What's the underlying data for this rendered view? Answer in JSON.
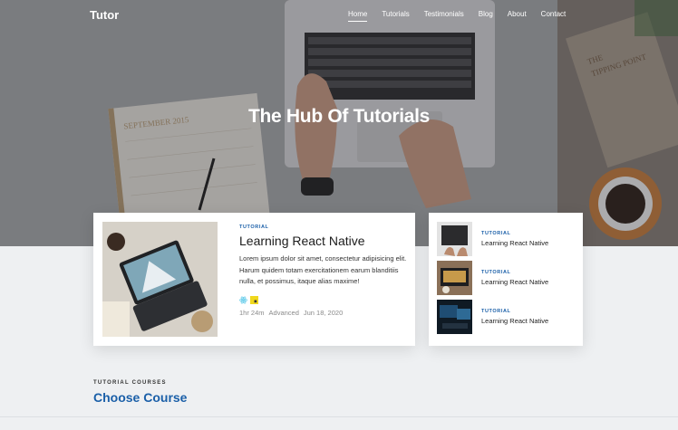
{
  "brand": "Tutor",
  "nav": {
    "items": [
      "Home",
      "Tutorials",
      "Testimonials",
      "Blog",
      "About",
      "Contact"
    ],
    "active": "Home"
  },
  "hero": {
    "title_pre": "The ",
    "title_bold1": "Hub",
    "title_mid": " Of ",
    "title_bold2": "Tutorials"
  },
  "featured": {
    "tag": "TUTORIAL",
    "title": "Learning React Native",
    "description": "Lorem ipsum dolor sit amet, consectetur adipisicing elit. Harum quidem totam exercitationem earum blanditiis nulla, et possimus, itaque alias maxime!",
    "duration": "1hr 24m",
    "level": "Advanced",
    "date": "Jun 18, 2020",
    "tech_icons": [
      "react-icon",
      "javascript-icon"
    ]
  },
  "side_list": [
    {
      "tag": "TUTORIAL",
      "title": "Learning React Native"
    },
    {
      "tag": "TUTORIAL",
      "title": "Learning React Native"
    },
    {
      "tag": "TUTORIAL",
      "title": "Learning React Native"
    }
  ],
  "courses": {
    "kicker": "TUTORIAL COURSES",
    "title": "Choose Course"
  },
  "colors": {
    "accent": "#1a5fa8",
    "text": "#1c1c1c",
    "muted": "#8a8a8a"
  }
}
